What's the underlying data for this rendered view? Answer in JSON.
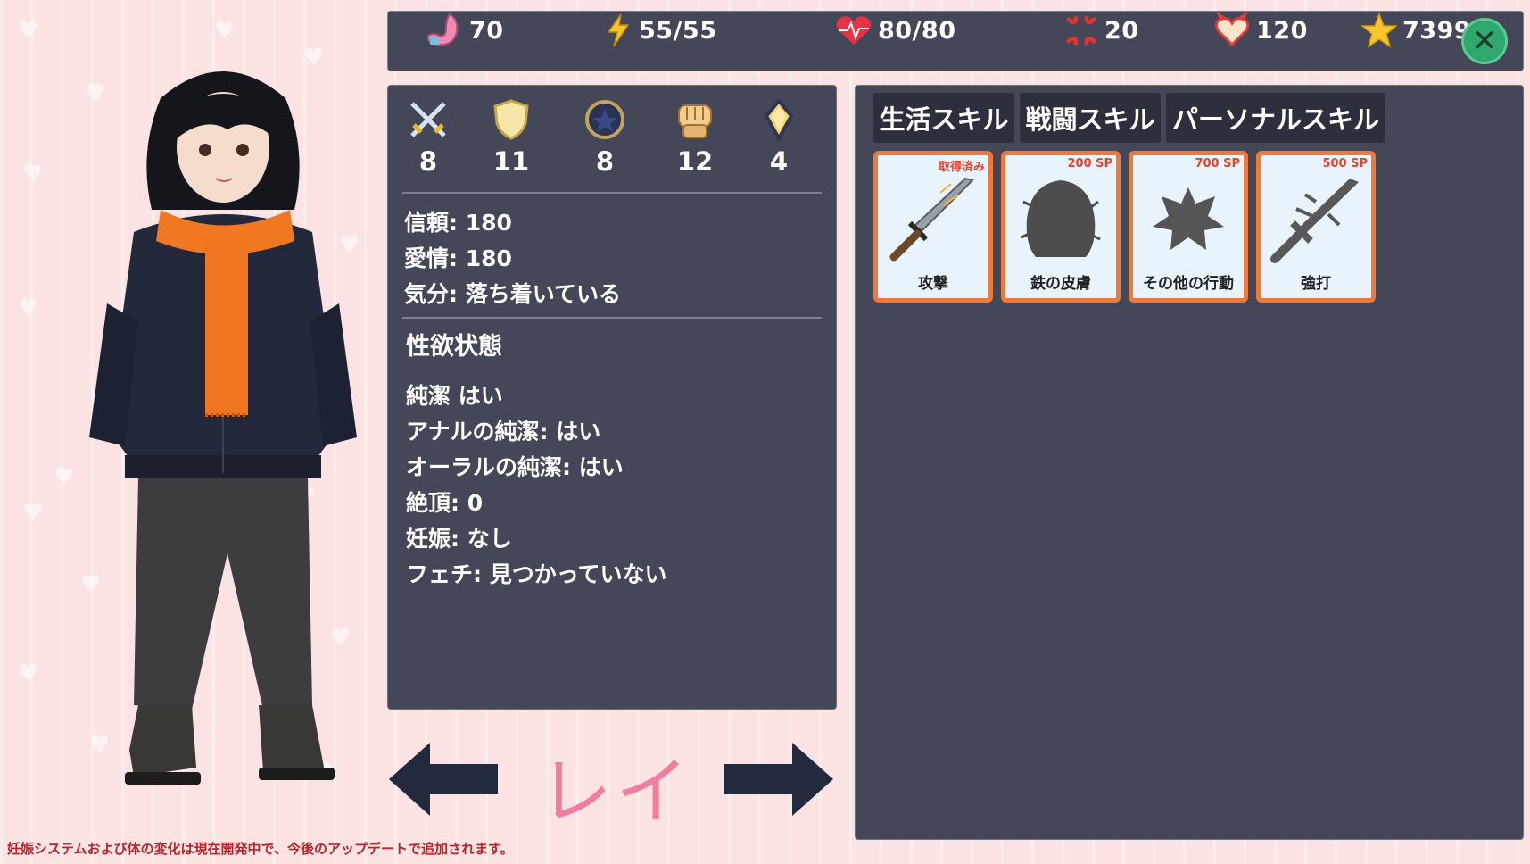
{
  "topbar": {
    "hunger": "70",
    "energy": "55/55",
    "health": "80/80",
    "anger": "20",
    "lust": "120",
    "money": "7399",
    "close_icon": "close-icon"
  },
  "attributes": [
    {
      "name": "sword",
      "value": "8"
    },
    {
      "name": "shield",
      "value": "11"
    },
    {
      "name": "medallion",
      "value": "8"
    },
    {
      "name": "fist",
      "value": "12"
    },
    {
      "name": "gem",
      "value": "4"
    }
  ],
  "relationship": {
    "trust": "信頼: 180",
    "affection": "愛情: 180",
    "mood": "気分: 落ち着いている"
  },
  "sexual": {
    "heading": "性欲状態",
    "lines": [
      "純潔 はい",
      "アナルの純潔: はい",
      "オーラルの純潔: はい",
      "絶頂: 0",
      "妊娠: なし",
      "フェチ: 見つかっていない"
    ]
  },
  "character": {
    "name": "レイ"
  },
  "skills": {
    "tabs": [
      "生活スキル",
      "戦闘スキル",
      "パーソナルスキル"
    ],
    "cards": [
      {
        "cost": "取得済み",
        "name": "攻撃"
      },
      {
        "cost": "200 SP",
        "name": "鉄の皮膚"
      },
      {
        "cost": "700 SP",
        "name": "その他の行動"
      },
      {
        "cost": "500 SP",
        "name": "強打"
      }
    ]
  },
  "footer": {
    "note": "妊娠システムおよび体の変化は現在開発中で、今後のアップデートで追加されます。"
  },
  "colors": {
    "panel": "#444757",
    "accent_orange": "#ee7a3a",
    "name_pink": "#f17c9d",
    "close_green": "#2fa86e"
  }
}
